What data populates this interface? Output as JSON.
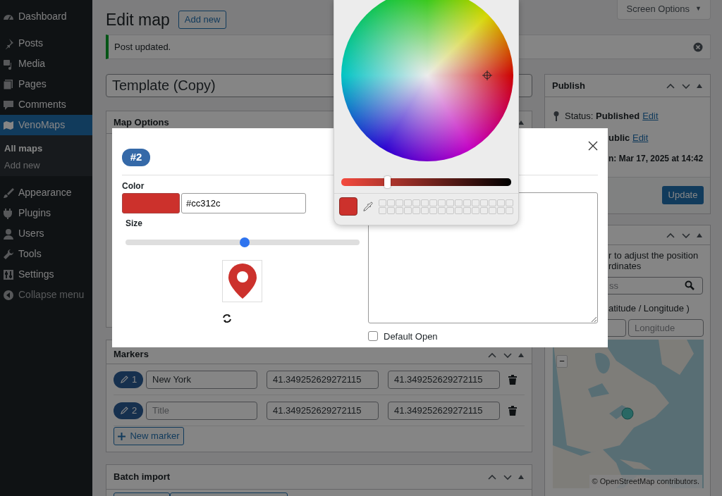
{
  "sidebar": {
    "items": [
      {
        "label": "Dashboard",
        "selected": false
      },
      {
        "label": "Posts",
        "selected": false
      },
      {
        "label": "Media",
        "selected": false
      },
      {
        "label": "Pages",
        "selected": false
      },
      {
        "label": "Comments",
        "selected": false
      },
      {
        "label": "VenoMaps",
        "selected": true,
        "children": [
          {
            "label": "All maps",
            "selected": true
          },
          {
            "label": "Add new",
            "selected": false
          }
        ]
      },
      {
        "label": "Appearance",
        "selected": false
      },
      {
        "label": "Plugins",
        "selected": false
      },
      {
        "label": "Users",
        "selected": false
      },
      {
        "label": "Tools",
        "selected": false
      },
      {
        "label": "Settings",
        "selected": false
      }
    ],
    "collapse": "Collapse menu"
  },
  "header": {
    "title": "Edit map",
    "add_new": "Add new",
    "screen_options": "Screen Options",
    "screen_options_caret": "▼"
  },
  "notice": {
    "text": "Post updated."
  },
  "title_field": {
    "value": "Template (Copy)"
  },
  "map_options": {
    "title": "Map Options"
  },
  "markers": {
    "title": "Markers",
    "rows": [
      {
        "number": "1",
        "title": {
          "value": "New York"
        },
        "lat": "41.349252629272115",
        "lng": "41.349252629272115"
      },
      {
        "number": "2",
        "title": {
          "placeholder": "Title"
        },
        "lat": "41.349252629272115",
        "lng": "41.349252629272115"
      }
    ],
    "new_marker": "New marker"
  },
  "batch_import": {
    "title": "Batch import"
  },
  "publish": {
    "title": "Publish",
    "status": "Status: **Published**",
    "status_edit": "Edit",
    "visibility": "ublic",
    "visibility_edit": "Edit",
    "published_on": "n: Mar 17, 2025 at 14:42",
    "update": "Update"
  },
  "location": {
    "help_lines": [
      "r to adjust the position",
      "rdinates"
    ],
    "address_placeholder": "ss",
    "coords_label": "atitude / Longitude )",
    "longitude_placeholder": "Longitude",
    "zoom_out": "−",
    "attribution": "© OpenStreetMap contributors."
  },
  "modal": {
    "badge": "#2",
    "color_label": "Color",
    "color_value": "#cc312c",
    "size_label": "Size",
    "size": {
      "level": 0.51
    },
    "default_open": {
      "label": "Default Open",
      "checked": false
    }
  },
  "picker": {
    "brightness": {
      "level": 0.27
    }
  }
}
